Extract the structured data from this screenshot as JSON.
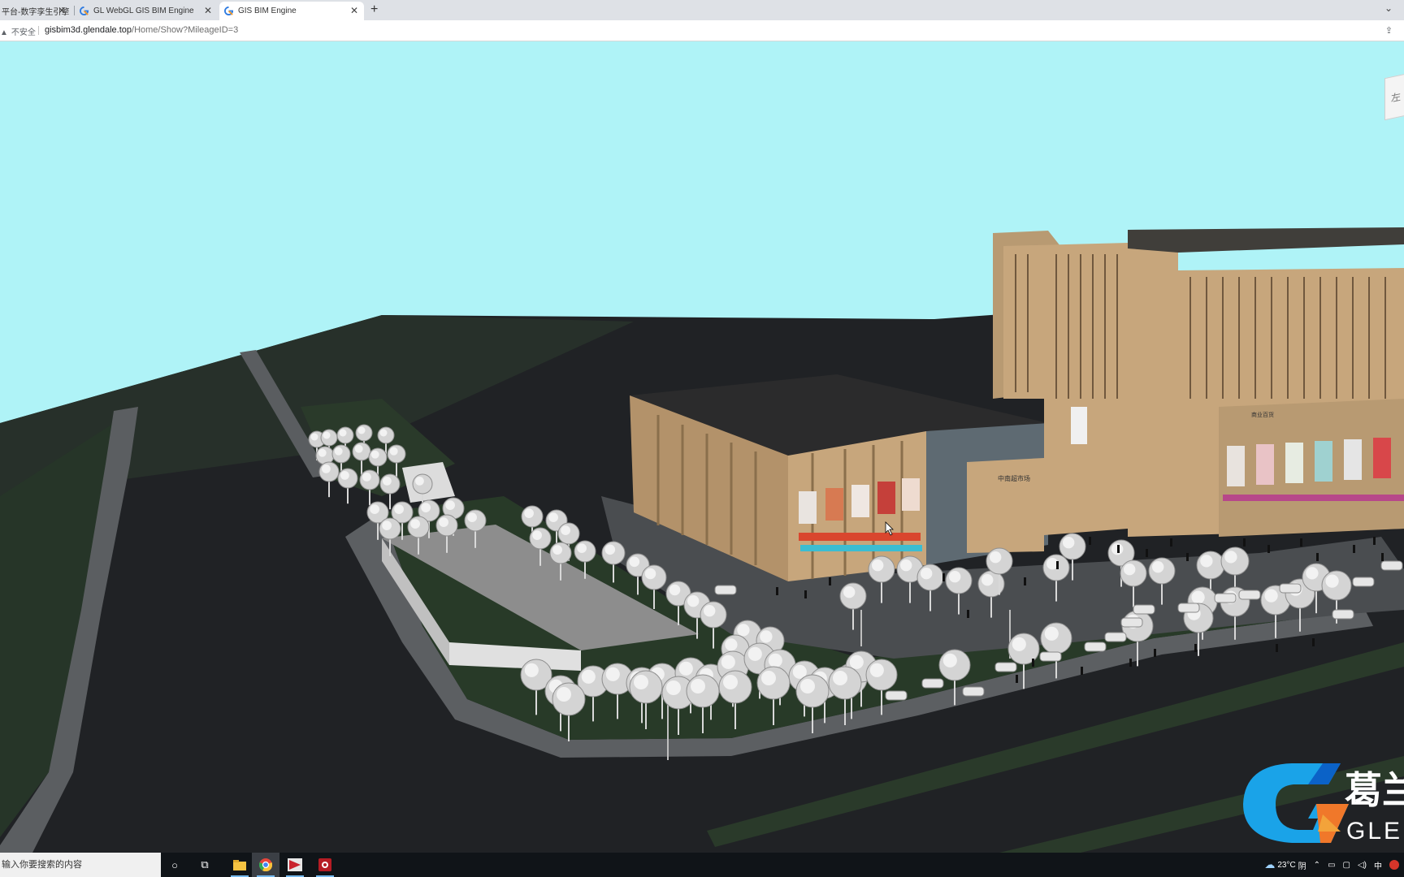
{
  "browser": {
    "tabs": [
      {
        "title": "平台-数字孪生引擎",
        "active": false
      },
      {
        "title": "GL WebGL GIS BIM Engine",
        "active": false
      },
      {
        "title": "GIS BIM Engine",
        "active": true
      }
    ],
    "new_tab_glyph": "+",
    "tab_close_glyph": "✕",
    "tabs_menu_glyph": "⌄",
    "security_label": "不安全",
    "url_host": "gisbim3d.glendale.top",
    "url_path": "/Home/Show?MileageID=3"
  },
  "viewer": {
    "nav_cube_face": "左",
    "logo_text_cn": "葛兰",
    "logo_text_en": "GLEN",
    "building_signs": [
      "中南超市场",
      "商业百货"
    ],
    "colors": {
      "sky": "#aff3f7",
      "ground": "#202225",
      "grass": "#283a28",
      "facade": "#c7a67c",
      "roof": "#2b2b2c",
      "paving": "#5c5f62"
    }
  },
  "taskbar": {
    "search_placeholder": "输入你要搜索的内容",
    "icons": [
      "cortana-icon",
      "task-view-icon",
      "file-explorer-icon",
      "chrome-icon",
      "app-red-icon",
      "app-record-icon"
    ],
    "weather_temp": "23°C",
    "weather_desc": "阴",
    "ime_label": "中"
  }
}
